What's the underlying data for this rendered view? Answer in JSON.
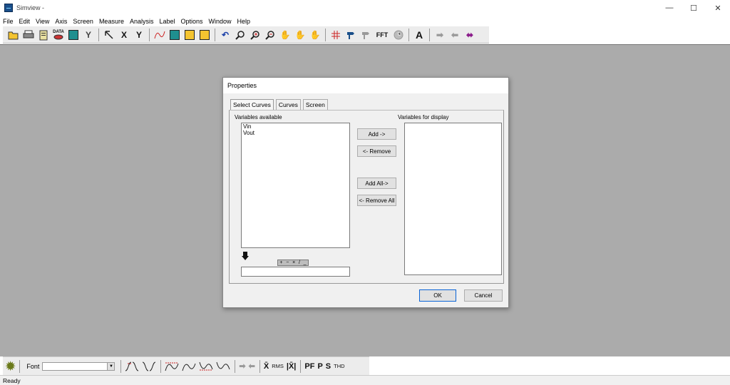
{
  "window": {
    "title": "Simview -",
    "controls": {
      "minimize": "—",
      "maximize": "☐",
      "close": "✕"
    }
  },
  "menu": [
    "File",
    "Edit",
    "View",
    "Axis",
    "Screen",
    "Measure",
    "Analysis",
    "Label",
    "Options",
    "Window",
    "Help"
  ],
  "toolbar": {
    "data_label": "DATA",
    "x_label": "X",
    "y_label": "Y",
    "yt_label": "Y",
    "fft_label": "FFT",
    "text_label": "A",
    "icons": [
      "open-icon",
      "print-icon",
      "clipboard-icon",
      "data-icon",
      "chart-icon",
      "xy-icon",
      "pointer-icon",
      "x-axis-icon",
      "y-axis-icon",
      "waveform-icon",
      "grid-icon",
      "screen-layout-icon",
      "screen-select-icon",
      "undo-icon",
      "zoom-icon",
      "zoom-in-icon",
      "zoom-out-icon",
      "pan-icon",
      "pan-x-icon",
      "pan-y-icon",
      "crosshair-icon",
      "marker-icon",
      "marker-gray-icon",
      "fft-icon",
      "clock-icon",
      "text-icon",
      "arrow-right-icon",
      "arrow-left-icon",
      "arrow-both-icon"
    ]
  },
  "dialog": {
    "title": "Properties",
    "tabs": [
      "Select Curves",
      "Curves",
      "Screen"
    ],
    "variables_available_label": "Variables available",
    "variables_available": [
      "Vin",
      "Vout"
    ],
    "variables_display_label": "Variables for display",
    "variables_display": [],
    "add_label": "Add ->",
    "remove_label": "<- Remove",
    "add_all_label": "Add All->",
    "remove_all_label": "<- Remove All",
    "operators": [
      "+",
      "−",
      "×",
      "/",
      "_"
    ],
    "ok_label": "OK",
    "cancel_label": "Cancel"
  },
  "bottom_toolbar": {
    "font_label": "Font",
    "font_value": "",
    "avg_label": "X̄",
    "rms_label": "RMS",
    "abs_avg_label": "|X̄|",
    "pf_label": "PF",
    "p_label": "P",
    "s_label": "S",
    "thd_label": "THD"
  },
  "status": {
    "text": "Ready"
  },
  "colors": {
    "canvas": "#ababab",
    "dialog": "#f0f0f0",
    "accent": "#0a64d6"
  }
}
